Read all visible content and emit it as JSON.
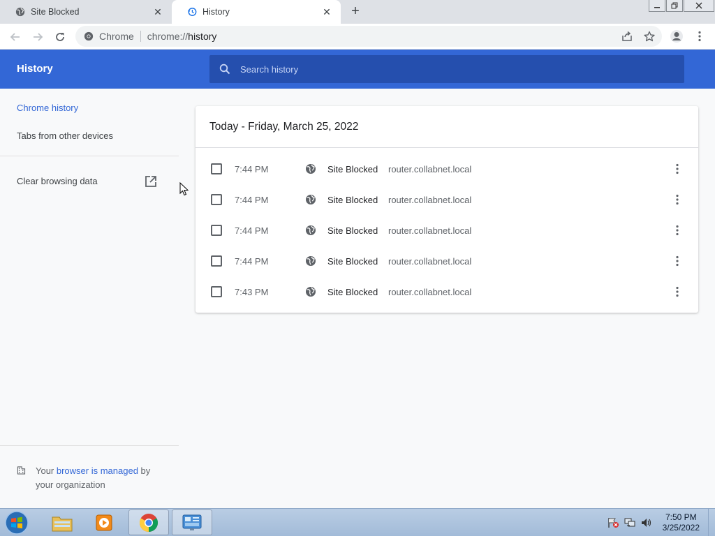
{
  "tabs": [
    {
      "title": "Site Blocked",
      "icon": "globe-icon"
    },
    {
      "title": "History",
      "icon": "history-icon"
    }
  ],
  "omnibox": {
    "chip": "Chrome",
    "url_prefix": "chrome://",
    "url_main": "history"
  },
  "history": {
    "title": "History",
    "search_placeholder": "Search history"
  },
  "sidebar": {
    "items": [
      {
        "label": "Chrome history"
      },
      {
        "label": "Tabs from other devices"
      },
      {
        "label": "Clear browsing data"
      }
    ],
    "managed": {
      "prefix": "Your ",
      "link": "browser is managed",
      "suffix": " by your organization"
    }
  },
  "card": {
    "heading": "Today - Friday, March 25, 2022",
    "entries": [
      {
        "time": "7:44 PM",
        "title": "Site Blocked",
        "domain": "router.collabnet.local"
      },
      {
        "time": "7:44 PM",
        "title": "Site Blocked",
        "domain": "router.collabnet.local"
      },
      {
        "time": "7:44 PM",
        "title": "Site Blocked",
        "domain": "router.collabnet.local"
      },
      {
        "time": "7:44 PM",
        "title": "Site Blocked",
        "domain": "router.collabnet.local"
      },
      {
        "time": "7:43 PM",
        "title": "Site Blocked",
        "domain": "router.collabnet.local"
      }
    ]
  },
  "taskbar": {
    "clock_time": "7:50 PM",
    "clock_date": "3/25/2022"
  },
  "colors": {
    "accent": "#3367d6",
    "search_bg": "#254fae"
  }
}
